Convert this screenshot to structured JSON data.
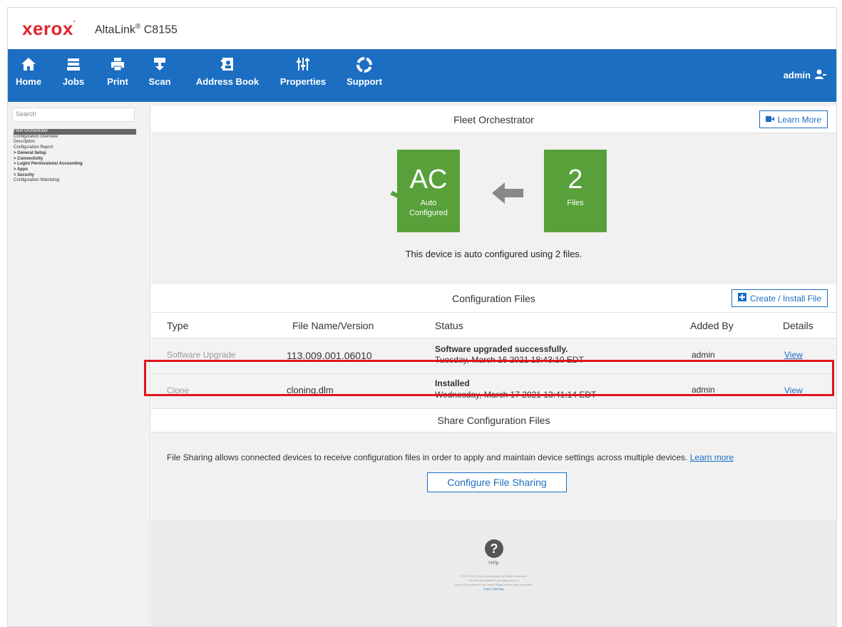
{
  "brand": {
    "logo": "xerox",
    "model_prefix": "AltaLink",
    "model_reg": "®",
    "model_suffix": " C8155"
  },
  "toolbar": {
    "items": [
      {
        "label": "Home",
        "icon": "home-icon"
      },
      {
        "label": "Jobs",
        "icon": "jobs-icon"
      },
      {
        "label": "Print",
        "icon": "printer-icon"
      },
      {
        "label": "Scan",
        "icon": "scan-icon"
      },
      {
        "label": "Address Book",
        "icon": "address-book-icon"
      },
      {
        "label": "Properties",
        "icon": "sliders-icon"
      },
      {
        "label": "Support",
        "icon": "lifebuoy-icon"
      }
    ],
    "user": "admin",
    "user_icon": "user-icon",
    "color": "#1b6ec2"
  },
  "sidebar": {
    "search_placeholder": "Search",
    "items": [
      {
        "label": "Fleet Orchestrator",
        "active": true
      },
      {
        "label": "Configuration Overview"
      },
      {
        "label": "Description"
      },
      {
        "label": "Configuration Report"
      },
      {
        "label": "> General Setup"
      },
      {
        "label": "> Connectivity"
      },
      {
        "label": "> Login/ Permissions/ Accounting"
      },
      {
        "label": "> Apps"
      },
      {
        "label": "> Security"
      },
      {
        "label": "Configuration Watchdog"
      }
    ]
  },
  "fleet": {
    "title": "Fleet Orchestrator",
    "learn_more": "Learn More",
    "tile_ac_big": "AC",
    "tile_ac_line1": "Auto",
    "tile_ac_line2": "Configured",
    "tile_files_big": "2",
    "tile_files_label": "Files",
    "description": "This device is auto configured using 2 files.",
    "tile_color": "#58a13a"
  },
  "config_files": {
    "title": "Configuration Files",
    "create_button": "Create / Install File",
    "columns": [
      "Type",
      "File Name/Version",
      "Status",
      "Added By",
      "Details"
    ],
    "rows": [
      {
        "type": "Software Upgrade",
        "file": "113.009.001.06010",
        "status_title": "Software upgraded successfully.",
        "status_date": "Tuesday, March 16 2021 18:43:10 EDT",
        "added_by": "admin",
        "details": "View"
      },
      {
        "type": "Clone",
        "file": "cloning.dlm",
        "status_title": "Installed",
        "status_date": "Wednesday, March 17 2021 13:41:14 EDT",
        "added_by": "admin",
        "details": "View"
      }
    ]
  },
  "share": {
    "title": "Share Configuration Files",
    "text": "File Sharing allows connected devices to receive configuration files in order to apply and maintain device settings across multiple devices.",
    "learn_more": "Learn more",
    "button": "Configure File Sharing"
  },
  "footer": {
    "help": "Help",
    "legal1": "©2017-2019 Xerox Corporation. All Rights Reserved.",
    "legal2": "Xerox® and Altalink® are trademarks of",
    "legal3": "Xerox Corporation in the United States and/or other countries.",
    "links": "Index | Site Map"
  },
  "highlight_color": "#e2141b"
}
